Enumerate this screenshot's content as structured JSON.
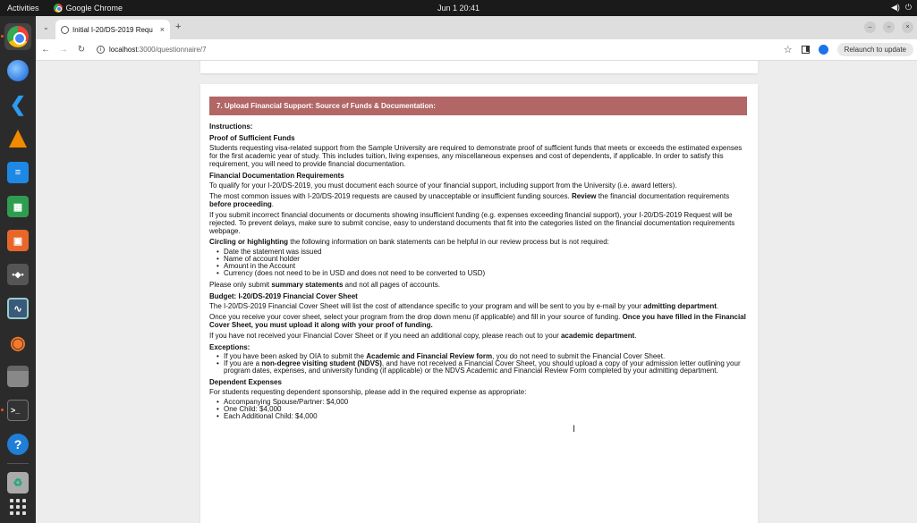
{
  "system": {
    "activities": "Activities",
    "app_name": "Google Chrome",
    "clock": "Jun 1  20:41"
  },
  "browser": {
    "tab_title": "Initial I-20/DS-2019 Requ",
    "url_host": "localhost",
    "url_path": ":3000/questionnaire/7",
    "relaunch_label": "Relaunch to update"
  },
  "section": {
    "title": "7. Upload Financial Support: Source of Funds & Documentation:",
    "instructions_heading": "Instructions:",
    "proof_heading": "Proof of Sufficient Funds",
    "proof_text": "Students requesting visa-related support from the Sample University are required to demonstrate proof of sufficient funds that meets or exceeds the estimated expenses for the first academic year of study. This includes tuition, living expenses, any miscellaneous expenses and cost of dependents, if applicable. In order to satisfy this requirement, you will need to provide financial documentation.",
    "fin_doc_heading": "Financial Documentation Requirements",
    "fin_doc_p1": "To qualify for your I-20/DS-2019, you must document each source of your financial support, including support from the University (i.e. award letters).",
    "fin_doc_p2_a": "The most common issues with I-20/DS-2019 requests are caused by unacceptable or insufficient funding sources. ",
    "fin_doc_p2_b": "Review",
    "fin_doc_p2_c": " the financial documentation requirements ",
    "fin_doc_p2_d": "before proceeding",
    "fin_doc_p2_e": ".",
    "fin_doc_p3": "If you submit incorrect financial documents or documents showing insufficient funding (e.g. expenses exceeding financial support), your I-20/DS-2019 Request will be rejected. To prevent delays, make sure to submit concise, easy to understand documents that fit into the categories listed on the financial documentation requirements webpage.",
    "circling_bold": "Circling or highlighting",
    "circling_rest": " the following information on bank statements can be helpful in our review process but is not required:",
    "bank_items": [
      "Date the statement was issued",
      "Name of account holder",
      "Amount in the Account",
      "Currency (does not need to be in USD and does not need to be converted to USD)"
    ],
    "summary_a": "Please only submit ",
    "summary_b": "summary statements",
    "summary_c": " and not all pages of accounts.",
    "budget_heading": "Budget: I-20/DS-2019 Financial Cover Sheet",
    "budget_p1_a": "The I-20/DS-2019 Financial Cover Sheet will list the cost of attendance specific to your program and will be sent to you by e-mail by your ",
    "budget_p1_b": "admitting department",
    "budget_p1_c": ".",
    "budget_p2_a": "Once you receive your cover sheet, select your program from the drop down menu (if applicable) and fill in your source of funding. ",
    "budget_p2_b": "Once you have filled in the Financial Cover Sheet, you must upload it along with your proof of funding.",
    "budget_p3_a": "If you have not received your Financial Cover Sheet or if you need an additional copy, please reach out to your ",
    "budget_p3_b": "academic department",
    "budget_p3_c": ".",
    "exceptions_heading": "Exceptions:",
    "exc1_a": "If you have been asked by OIA to submit the ",
    "exc1_b": "Academic and Financial Review form",
    "exc1_c": ", you do not need to submit the Financial Cover Sheet.",
    "exc2_a": "If you are a ",
    "exc2_b": "non-degree visiting student (NDVS)",
    "exc2_c": ", and have not received a Financial Cover Sheet, you should upload a copy of your admission letter outlining your program dates, expenses, and university funding (if applicable) or the NDVS Academic and Financial Review Form completed by your admitting department.",
    "dependent_heading": "Dependent Expenses",
    "dependent_text": "For students requesting dependent sponsorship, please add in the required expense as appropriate:",
    "dependent_items": [
      "Accompanying Spouse/Partner: $4,000",
      "One Child: $4,000",
      "Each Additional Child: $4,000"
    ]
  }
}
